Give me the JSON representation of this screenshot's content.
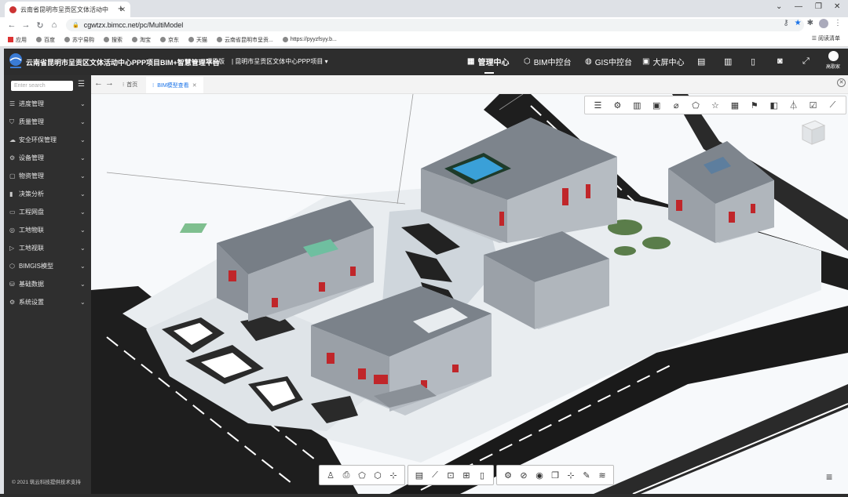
{
  "browser": {
    "tab_title": "云南省昆明市呈贡区文体活动中",
    "url": "cgwtzx.bimcc.net/pc/MultiModel"
  },
  "bookmarks": {
    "items": [
      "应用",
      "百度",
      "苏宁易购",
      "搜索",
      "淘宝",
      "京东",
      "天猫",
      "云南省昆明市呈贡...",
      "https://pyyzfsyy.b..."
    ],
    "reading_list": "阅读清单"
  },
  "header": {
    "title": "云南省昆明市呈贡区文体活动中心PPP项目BIM+智慧管理平台",
    "project_label": "项目版",
    "project_name": "昆明市呈贡区文体中心PPP项目",
    "nav": [
      {
        "label": "管理中心"
      },
      {
        "label": "BIM中控台"
      },
      {
        "label": "GIS中控台"
      },
      {
        "label": "大屏中心"
      }
    ],
    "user": "高歌家"
  },
  "sidebar": {
    "search_placeholder": "Enter search",
    "items": [
      {
        "label": "进度管理",
        "icon": "sliders-icon"
      },
      {
        "label": "质量管理",
        "icon": "shield-icon"
      },
      {
        "label": "安全环保管理",
        "icon": "cloud-icon"
      },
      {
        "label": "设备管理",
        "icon": "gear-icon"
      },
      {
        "label": "物资管理",
        "icon": "box-icon"
      },
      {
        "label": "决策分析",
        "icon": "bar-chart-icon"
      },
      {
        "label": "工程网盘",
        "icon": "disk-icon"
      },
      {
        "label": "工地物联",
        "icon": "iot-icon"
      },
      {
        "label": "工地视联",
        "icon": "camera-icon"
      },
      {
        "label": "BIMGIS模型",
        "icon": "cube-icon"
      },
      {
        "label": "基础数据",
        "icon": "database-icon"
      },
      {
        "label": "系统设置",
        "icon": "settings-icon"
      }
    ],
    "footer": "© 2021 筑云科技提供技术支持"
  },
  "tabs": [
    {
      "label": "首页"
    },
    {
      "label": "BIM模型查看"
    }
  ]
}
